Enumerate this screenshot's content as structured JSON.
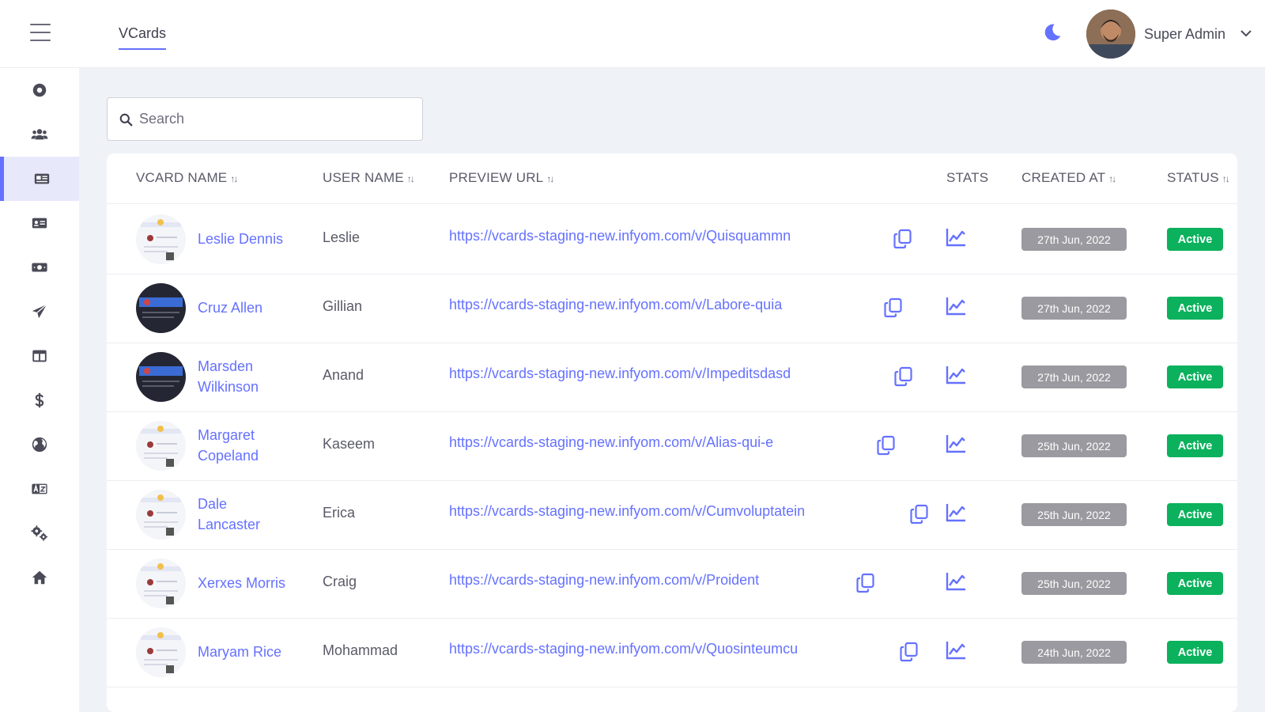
{
  "header": {
    "tab": "VCards",
    "user_name": "Super Admin"
  },
  "sidebar": {
    "icons": [
      "dashboard-icon",
      "users-icon",
      "vcard-icon",
      "id-card-icon",
      "money-icon",
      "send-icon",
      "layout-icon",
      "dollar-icon",
      "globe-icon",
      "language-icon",
      "settings-icon",
      "home-icon"
    ],
    "active_index": 2
  },
  "search": {
    "placeholder": "Search"
  },
  "table": {
    "headers": {
      "vcard_name": "VCARD NAME",
      "user_name": "USER NAME",
      "preview_url": "PREVIEW URL",
      "stats": "STATS",
      "created_at": "CREATED AT",
      "status": "STATUS"
    },
    "rows": [
      {
        "vcard_name": [
          "Leslie Dennis"
        ],
        "user_name": "Leslie",
        "preview_url": "https://vcards-staging-new.infyom.com/v/Quisquammn",
        "created_at": "27th Jun, 2022",
        "status": "Active"
      },
      {
        "vcard_name": [
          "Cruz Allen"
        ],
        "user_name": "Gillian",
        "preview_url": "https://vcards-staging-new.infyom.com/v/Labore-quia",
        "created_at": "27th Jun, 2022",
        "status": "Active"
      },
      {
        "vcard_name": [
          "Marsden",
          "Wilkinson"
        ],
        "user_name": "Anand",
        "preview_url": "https://vcards-staging-new.infyom.com/v/Impeditsdasd",
        "created_at": "27th Jun, 2022",
        "status": "Active"
      },
      {
        "vcard_name": [
          "Margaret",
          "Copeland"
        ],
        "user_name": "Kaseem",
        "preview_url": "https://vcards-staging-new.infyom.com/v/Alias-qui-e",
        "created_at": "25th Jun, 2022",
        "status": "Active"
      },
      {
        "vcard_name": [
          "Dale",
          "Lancaster"
        ],
        "user_name": "Erica",
        "preview_url": "https://vcards-staging-new.infyom.com/v/Cumvoluptatein",
        "created_at": "25th Jun, 2022",
        "status": "Active"
      },
      {
        "vcard_name": [
          "Xerxes Morris"
        ],
        "user_name": "Craig",
        "preview_url": "https://vcards-staging-new.infyom.com/v/Proident",
        "created_at": "25th Jun, 2022",
        "status": "Active"
      },
      {
        "vcard_name": [
          "Maryam Rice"
        ],
        "user_name": "Mohammad",
        "preview_url": "https://vcards-staging-new.infyom.com/v/Quosinteumcu",
        "created_at": "24th Jun, 2022",
        "status": "Active"
      }
    ]
  },
  "colors": {
    "accent": "#6571ff",
    "status_active": "#0bb15c",
    "date_badge": "#9a9aa0"
  }
}
